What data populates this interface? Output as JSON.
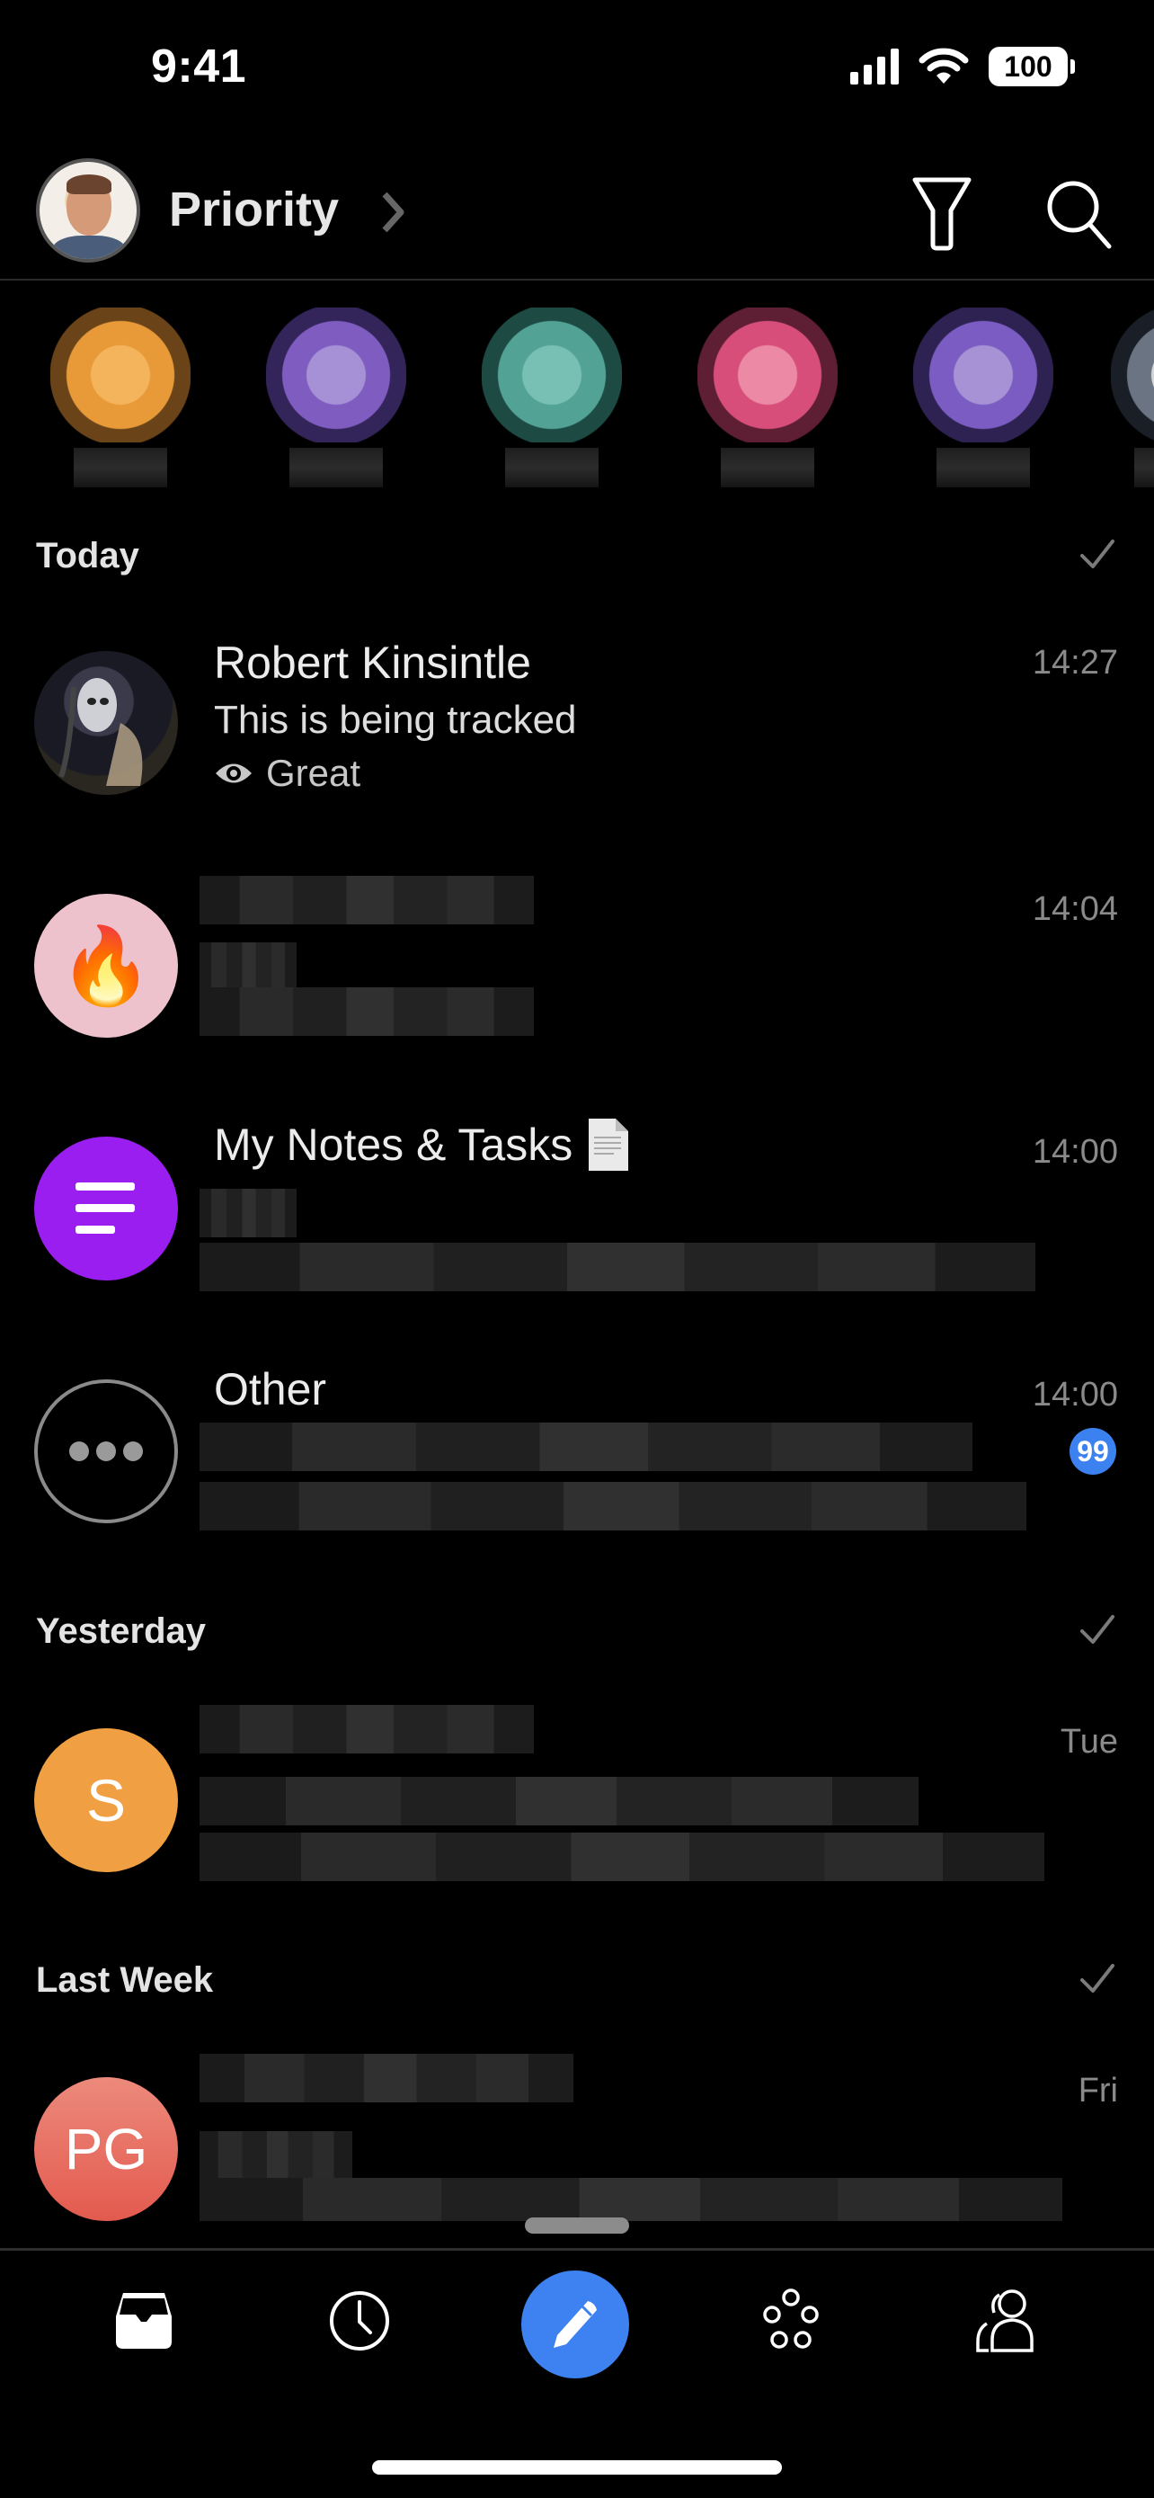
{
  "status_bar": {
    "time": "9:41",
    "battery": "100",
    "icons": [
      "signal-icon",
      "wifi-icon",
      "battery-icon"
    ]
  },
  "header": {
    "title": "Priority",
    "actions": [
      "filter-icon",
      "search-icon"
    ]
  },
  "stories": [
    {
      "color": "#f0a444"
    },
    {
      "color": "#8a64c8"
    },
    {
      "color": "#5ab3a6"
    },
    {
      "color": "#e05c84"
    },
    {
      "color": "#8a66c6"
    },
    {
      "color": "#c8c8c8"
    }
  ],
  "sections": [
    {
      "title": "Today",
      "items": [
        {
          "name": "Robert Kinsintle",
          "preview": "This is being tracked",
          "status": "Great",
          "status_icon": "eye-icon",
          "time": "14:27"
        },
        {
          "name": "",
          "preview": "",
          "time": "14:04",
          "avatar_emoji": "🔥"
        },
        {
          "name": "My Notes & Tasks",
          "name_emoji": "📄",
          "preview": "",
          "time": "14:00"
        },
        {
          "name": "Other",
          "preview": "",
          "time": "14:00",
          "badge": "99"
        }
      ]
    },
    {
      "title": "Yesterday",
      "items": [
        {
          "name": "",
          "preview": "",
          "time": "Tue",
          "avatar_initials": "S",
          "avatar_color": "#f0a042"
        }
      ]
    },
    {
      "title": "Last Week",
      "items": [
        {
          "name": "",
          "preview": "",
          "time": "Fri",
          "avatar_initials": "PG",
          "avatar_color": "#e8605a"
        }
      ]
    }
  ],
  "tabbar": {
    "tabs": [
      "inbox-icon",
      "clock-icon",
      "compose-icon",
      "groups-icon",
      "contacts-icon"
    ],
    "accent": "#3d82f0"
  }
}
